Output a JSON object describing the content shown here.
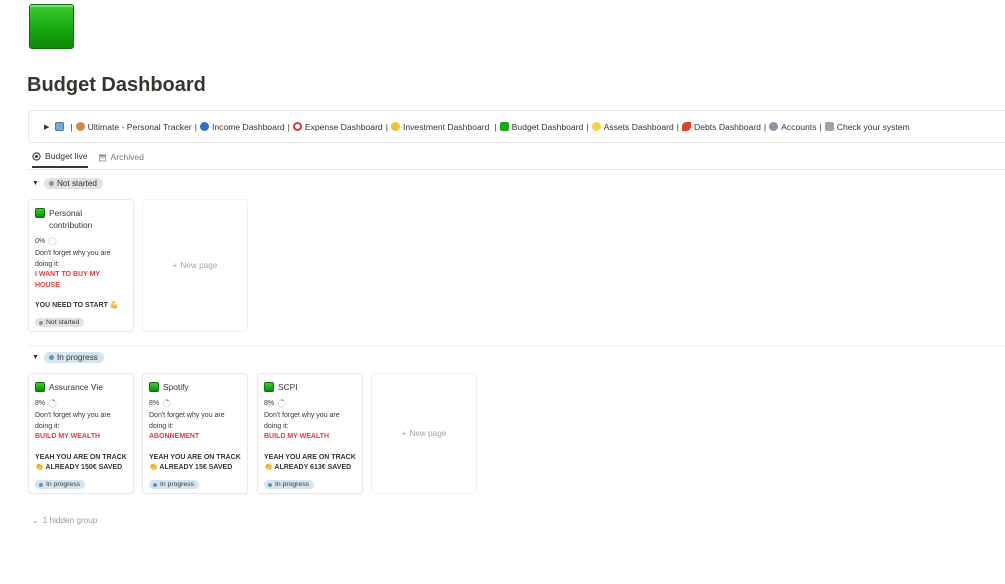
{
  "page": {
    "title": "Budget Dashboard",
    "icon": "green-square-icon"
  },
  "nav": {
    "links": [
      {
        "label": "Ultimate - Personal Tracker",
        "icon": "tracker-icon"
      },
      {
        "label": "Income Dashboard",
        "icon": "globe-icon"
      },
      {
        "label": "Expense Dashboard",
        "icon": "magnifier-icon"
      },
      {
        "label": "Investment Dashboard",
        "icon": "coin-icon"
      },
      {
        "label": "Budget Dashboard",
        "icon": "green-square-icon"
      },
      {
        "label": "Assets Dashboard",
        "icon": "sparkle-icon"
      },
      {
        "label": "Debts Dashboard",
        "icon": "chili-icon"
      },
      {
        "label": "Accounts",
        "icon": "gear-icon"
      },
      {
        "label": "Check your system",
        "icon": "checklist-icon"
      }
    ],
    "separator": "|"
  },
  "tabs": {
    "active": "Budget live",
    "archived": "Archived"
  },
  "groups": {
    "not_started": {
      "label": "Not started",
      "cards": [
        {
          "title_line1": "Personal",
          "title_line2": "contribution",
          "progress": "0%",
          "progress_value": 0,
          "reminder": "Don't forget why you are doing it:",
          "goal_line1": "I WANT TO BUY MY",
          "goal_line2": "HOUSE",
          "status_line": "YOU NEED TO START 💪",
          "status": "Not started"
        }
      ],
      "new_page": "New page"
    },
    "in_progress": {
      "label": "In progress",
      "cards": [
        {
          "title": "Assurance Vie",
          "progress": "8%",
          "progress_value": 0.08,
          "reminder": "Don't forget why you are doing it:",
          "goal": "BUILD MY WEALTH",
          "track": "YEAH YOU ARE ON TRACK",
          "saved": "👏 ALREADY 150€ SAVED",
          "status": "In progress"
        },
        {
          "title": "Spotify",
          "progress": "8%",
          "progress_value": 0.08,
          "reminder": "Don't forget why you are doing it:",
          "goal": "ABONNEMENT",
          "track": "YEAH YOU ARE ON TRACK",
          "saved": "👏 ALREADY 15€ SAVED",
          "status": "In progress"
        },
        {
          "title": "SCPI",
          "progress": "8%",
          "progress_value": 0.08,
          "reminder": "Don't forget why you are doing it:",
          "goal": "BUILD MY WEALTH",
          "track": "YEAH YOU ARE ON TRACK",
          "saved": "👏 ALREADY 613€ SAVED",
          "status": "In progress"
        }
      ],
      "new_page": "New page"
    }
  },
  "hidden_group": "1 hidden group",
  "colors": {
    "goal_red": "#e03e3e",
    "status_blue_bg": "#d3e5ef",
    "status_grey_bg": "#e3e2e0",
    "brand_green": "#16a80f"
  }
}
